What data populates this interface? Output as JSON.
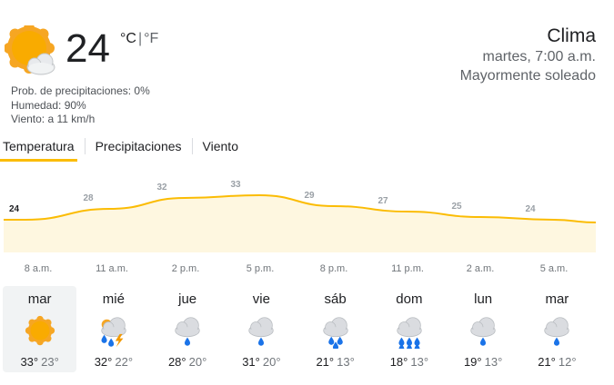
{
  "current": {
    "temp": "24",
    "unit_c": "°C",
    "unit_sep": "|",
    "unit_f": "°F",
    "icon": "sun-partly-cloudy-icon",
    "precip": "Prob. de precipitaciones: 0%",
    "humidity": "Humedad: 90%",
    "wind": "Viento: a 11 km/h"
  },
  "location": {
    "title": "Clima",
    "datetime": "martes, 7:00 a.m.",
    "condition": "Mayormente soleado"
  },
  "tabs": [
    {
      "label": "Temperatura",
      "active": true
    },
    {
      "label": "Precipitaciones",
      "active": false
    },
    {
      "label": "Viento",
      "active": false
    }
  ],
  "chart_data": {
    "type": "area",
    "series": [
      {
        "values": [
          24,
          28,
          32,
          33,
          29,
          27,
          25,
          24
        ]
      }
    ],
    "x": [
      "8 a.m.",
      "11 a.m.",
      "2 p.m.",
      "5 p.m.",
      "8 p.m.",
      "11 p.m.",
      "2 a.m.",
      "5 a.m."
    ],
    "colors": {
      "fill": "#fef7e0",
      "line": "#fbbc04"
    }
  },
  "days": [
    {
      "name": "mar",
      "icon": "sun-icon",
      "hi": "33°",
      "lo": "23°",
      "selected": true
    },
    {
      "name": "mié",
      "icon": "thunderstorm-icon",
      "hi": "32°",
      "lo": "22°",
      "selected": false
    },
    {
      "name": "jue",
      "icon": "light-rain-icon",
      "hi": "28°",
      "lo": "20°",
      "selected": false
    },
    {
      "name": "vie",
      "icon": "light-rain-icon",
      "hi": "31°",
      "lo": "20°",
      "selected": false
    },
    {
      "name": "sáb",
      "icon": "showers-icon",
      "hi": "21°",
      "lo": "13°",
      "selected": false
    },
    {
      "name": "dom",
      "icon": "heavy-rain-icon",
      "hi": "18°",
      "lo": "13°",
      "selected": false
    },
    {
      "name": "lun",
      "icon": "light-rain-icon",
      "hi": "19°",
      "lo": "13°",
      "selected": false
    },
    {
      "name": "mar",
      "icon": "light-rain-icon",
      "hi": "21°",
      "lo": "12°",
      "selected": false
    }
  ]
}
